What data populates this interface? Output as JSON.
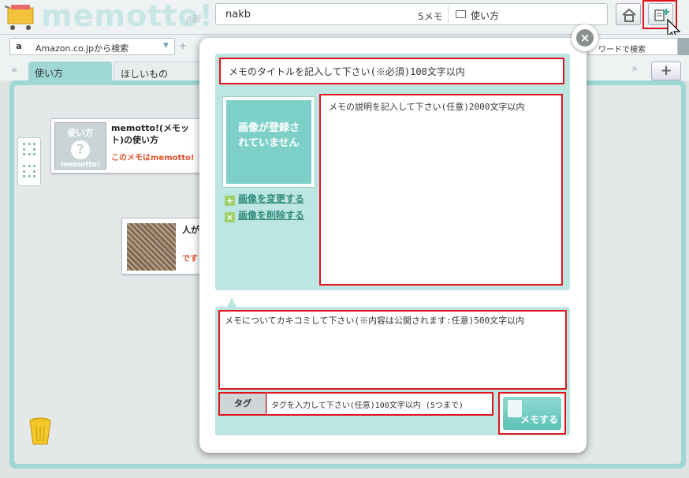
{
  "app": {
    "logo": "memotto!",
    "beta_label": "β版"
  },
  "header": {
    "user_name": "nakb",
    "memo_count": "5メモ",
    "folder_name": "使い方"
  },
  "search": {
    "amazon_label": "Amazon.co.jpから検索",
    "plus": "+",
    "keyword_label": "ワードで検索"
  },
  "tabs": [
    {
      "label": "使い方",
      "active": true
    },
    {
      "label": "ほしいもの",
      "active": false
    }
  ],
  "tab_nav": {
    "prev": "«",
    "next": "»",
    "add": "+"
  },
  "cards": {
    "card1": {
      "icon_label": "使い方",
      "icon_glyph": "?",
      "icon_sub": "memotto!",
      "title": "memotto!(メモット)の使い方",
      "subtitle": "このメモはmemotto!"
    },
    "card2": {
      "title": "人が",
      "subtitle": "です"
    }
  },
  "modal": {
    "close": "×",
    "title_placeholder": "メモのタイトルを記入して下さい(※必須)100文字以内",
    "image_placeholder": "画像が登録されていません",
    "change_image": "画像を変更する",
    "delete_image": "画像を削除する",
    "description_placeholder": "メモの説明を記入して下さい(任意)2000文字以内",
    "comment_placeholder": "メモについてカキコミして下さい(※内容は公開されます:任意)500文字以内",
    "tag_label": "タグ",
    "tag_placeholder": "タグを入力して下さい(任意)100文字以内 (5つまで)",
    "submit_label": "メモする"
  },
  "colors": {
    "accent": "#9ed7d3",
    "highlight": "#e0141e",
    "link": "#2f8a7c",
    "warning_text": "#e0502a"
  },
  "icons": [
    "cart-icon",
    "home-icon",
    "new-memo-icon",
    "folder-icon",
    "close-icon",
    "plus-icon",
    "x-icon",
    "trash-icon",
    "question-icon"
  ]
}
